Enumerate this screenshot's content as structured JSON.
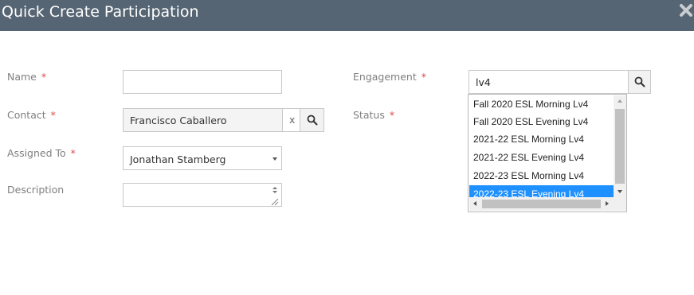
{
  "dialog": {
    "title": "Quick Create Participation"
  },
  "form": {
    "name": {
      "label": "Name",
      "required_mark": "*",
      "value": ""
    },
    "contact": {
      "label": "Contact",
      "required_mark": "*",
      "value": "Francisco Caballero",
      "clear_label": "x"
    },
    "assigned_to": {
      "label": "Assigned To",
      "required_mark": "*",
      "value": "Jonathan Stamberg"
    },
    "description": {
      "label": "Description",
      "value": ""
    },
    "engagement": {
      "label": "Engagement",
      "required_mark": "*",
      "value": "lv4"
    },
    "status": {
      "label": "Status",
      "required_mark": "*"
    }
  },
  "autocomplete": {
    "options": [
      "Fall 2020 ESL Morning Lv4",
      "Fall 2020 ESL Evening Lv4",
      "2021-22 ESL Morning Lv4",
      "2021-22 ESL Evening Lv4",
      "2022-23 ESL Morning Lv4",
      "2022-23 ESL Evening Lv4"
    ],
    "selected_index": 5
  },
  "icons": {
    "close": "close-icon",
    "search": "search-icon",
    "dropdown": "chevron-down-icon"
  },
  "colors": {
    "header_bg": "#566573",
    "required": "#e0484a",
    "selection": "#1e90ff"
  }
}
